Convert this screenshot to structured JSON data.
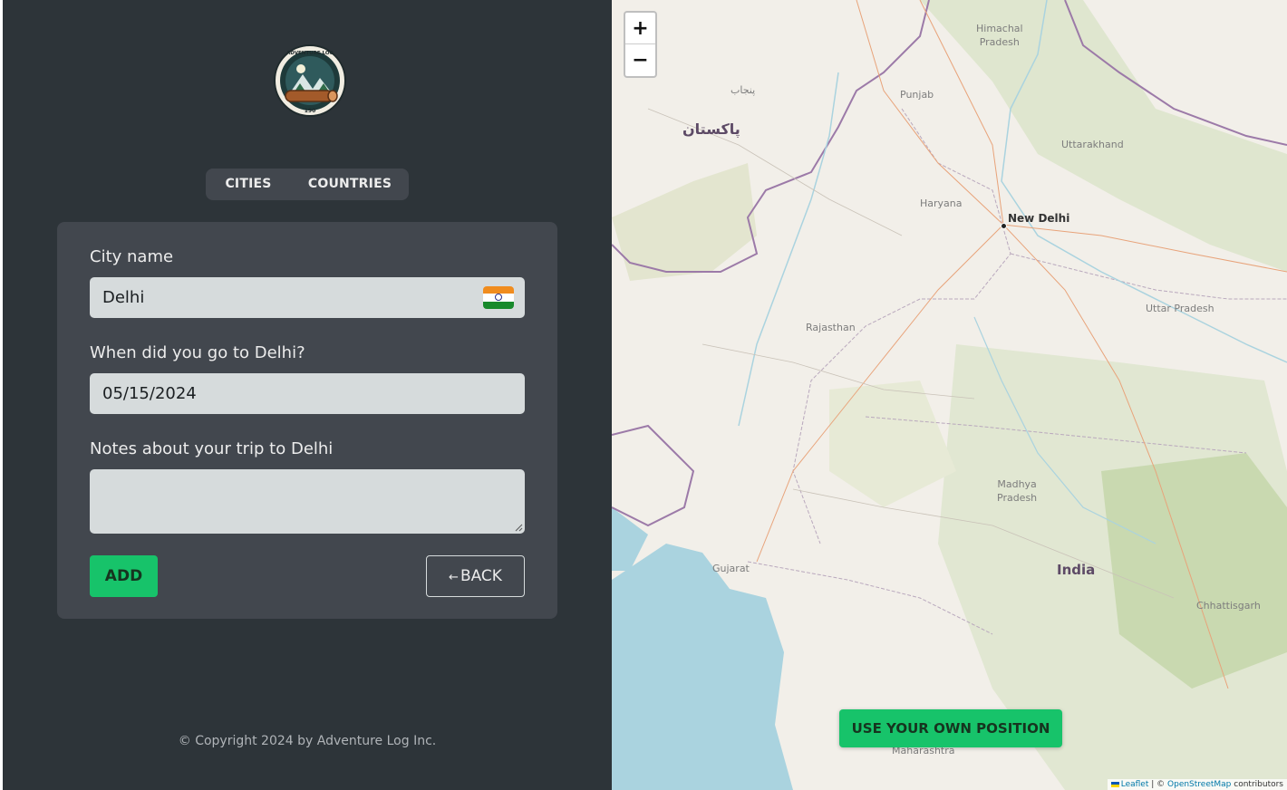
{
  "tabs": [
    {
      "label": "CITIES"
    },
    {
      "label": "COUNTRIES"
    }
  ],
  "form": {
    "city_label": "City name",
    "city_value": "Delhi",
    "date_label": "When did you go to Delhi?",
    "date_value": "05/15/2024",
    "notes_label": "Notes about your trip to Delhi",
    "notes_value": "",
    "add_label": "ADD",
    "back_arrow": "←",
    "back_label": "BACK"
  },
  "footer": {
    "copyright": "© Copyright 2024 by Adventure Log Inc."
  },
  "map": {
    "zoom_in": "+",
    "zoom_out": "−",
    "labels": {
      "pakistan": "پاکستان",
      "punjab_ur": "پنجاب",
      "himachal": "Himachal\nPradesh",
      "punjab": "Punjab",
      "uttarakhand": "Uttarakhand",
      "haryana": "Haryana",
      "new_delhi": "New Delhi",
      "rajasthan": "Rajasthan",
      "uttar_pradesh": "Uttar Pradesh",
      "madhya": "Madhya\nPradesh",
      "gujarat": "Gujarat",
      "india": "India",
      "chhattisgarh": "Chhattisgarh",
      "maharashtra": "Maharashtra"
    },
    "use_position": "USE YOUR OWN POSITION",
    "attribution": {
      "leaflet": "Leaflet",
      "sep": " | © ",
      "osm": "OpenStreetMap",
      "contributors": " contributors"
    }
  },
  "colors": {
    "sidebar_bg": "#2d3439",
    "card_bg": "#42474e",
    "accent_green": "#17c36a",
    "input_bg": "#d6dbdc"
  }
}
